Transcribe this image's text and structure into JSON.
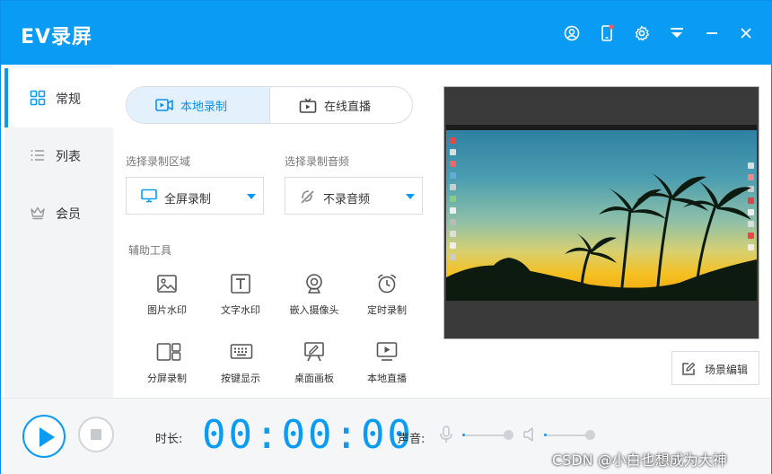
{
  "app": {
    "title": "EV录屏",
    "window_controls": [
      "user-icon",
      "phone-icon",
      "gear-icon",
      "dropdown-menu-icon",
      "minimize-icon",
      "close-icon"
    ]
  },
  "sidebar": {
    "items": [
      {
        "label": "常规",
        "icon": "grid-icon",
        "active": true
      },
      {
        "label": "列表",
        "icon": "list-icon",
        "active": false
      },
      {
        "label": "会员",
        "icon": "crown-icon",
        "active": false
      }
    ]
  },
  "mode_tabs": [
    {
      "label": "本地录制",
      "icon": "record-icon",
      "active": true
    },
    {
      "label": "在线直播",
      "icon": "tv-icon",
      "active": false
    }
  ],
  "record_area": {
    "label": "选择录制区域",
    "value": "全屏录制",
    "icon": "monitor-icon"
  },
  "record_audio": {
    "label": "选择录制音频",
    "value": "不录音频",
    "icon": "mute-icon"
  },
  "tools": {
    "label": "辅助工具",
    "items": [
      {
        "label": "图片水印",
        "icon": "image-icon"
      },
      {
        "label": "文字水印",
        "icon": "text-icon"
      },
      {
        "label": "嵌入摄像头",
        "icon": "webcam-icon"
      },
      {
        "label": "定时录制",
        "icon": "alarm-clock-icon"
      },
      {
        "label": "分屏录制",
        "icon": "split-screen-icon"
      },
      {
        "label": "按键显示",
        "icon": "keyboard-icon"
      },
      {
        "label": "桌面画板",
        "icon": "easel-icon"
      },
      {
        "label": "本地直播",
        "icon": "local-live-icon"
      }
    ]
  },
  "scene_edit": {
    "label": "场景编辑",
    "icon": "edit-icon"
  },
  "bottom": {
    "duration_label": "时长:",
    "timer": "00:00:00",
    "sound_label": "声音:"
  },
  "colors": {
    "accent": "#0a9bf5",
    "sidebar_bg": "#f3f4f6",
    "bottom_bg": "#f5f6f8"
  },
  "watermark": "CSDN @小白也想成为大神"
}
